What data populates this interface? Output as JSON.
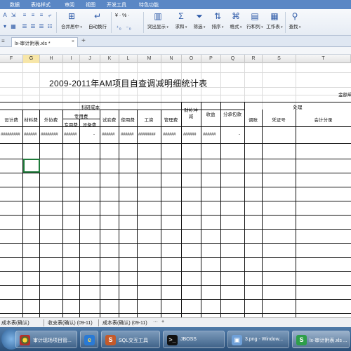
{
  "menubar": {
    "tabs": [
      "数据",
      "表格样式",
      "审阅",
      "视图",
      "开发工具",
      "特色功能"
    ]
  },
  "ribbon": {
    "merge_label": "合并居中",
    "wrap_label": "自动换行",
    "number_format": "¥ · % ·",
    "highlight_label": "突出显示",
    "sum_label": "求和",
    "filter_label": "筛选",
    "sort_label": "排序",
    "format_label": "格式",
    "rowcol_label": "行和列",
    "sheet_label": "工作表",
    "find_label": "查找"
  },
  "doc_tab": {
    "name": "lx-审计附表.xls *",
    "close": "×",
    "new": "+"
  },
  "columns": [
    "F",
    "G",
    "H",
    "I",
    "J",
    "K",
    "L",
    "M",
    "N",
    "O",
    "P",
    "Q",
    "R",
    "S",
    "T"
  ],
  "selected_column": "G",
  "sheet": {
    "title": "2009-2011年AM项目自查调减明细统计表",
    "unit_label": "金额单",
    "group_header": "科研成本",
    "process_header": "处理",
    "sub_header_special": "专用费",
    "headers": {
      "design": "设计费",
      "material": "材料费",
      "outsource": "外协费",
      "special_fee": "专用费",
      "equipment": "设备费",
      "test": "试验费",
      "usage": "使用费",
      "wage": "工资",
      "management": "管理费",
      "subsidy": "财补冲减",
      "income": "收益",
      "subcontract": "分承包款",
      "adjust": "调账",
      "voucher": "凭证号",
      "account": "会计分录"
    },
    "row1": {
      "design": "#########",
      "material": "######",
      "outsource": "########",
      "special_fee": "######",
      "equipment": "-",
      "test": "######",
      "usage": "######",
      "wage": "########",
      "management": "######",
      "subsidy": "######",
      "income": "######",
      "subcontract": "-"
    }
  },
  "sheet_tabs": [
    "成本表(确认)",
    "收支表(确认) (09-11)",
    "成本表(确认) (09-11)"
  ],
  "sheet_tabs_more": "···",
  "sheet_tabs_add": "+",
  "taskbar": [
    {
      "label": "审计现场项目管...",
      "icon": "chrome-icon"
    },
    {
      "label": "",
      "icon": "ie-icon"
    },
    {
      "label": "SQL交互工具",
      "icon": "sql-icon"
    },
    {
      "label": "JBOSS",
      "icon": "terminal-icon"
    },
    {
      "label": "3.png - Window...",
      "icon": "image-icon"
    },
    {
      "label": "lx-审计附表.xls ...",
      "icon": "spreadsheet-icon"
    }
  ],
  "colors": {
    "ribbon_bar": "#5a87c5",
    "selection": "#1f7a3a",
    "taskbar": "#2a4f78"
  }
}
